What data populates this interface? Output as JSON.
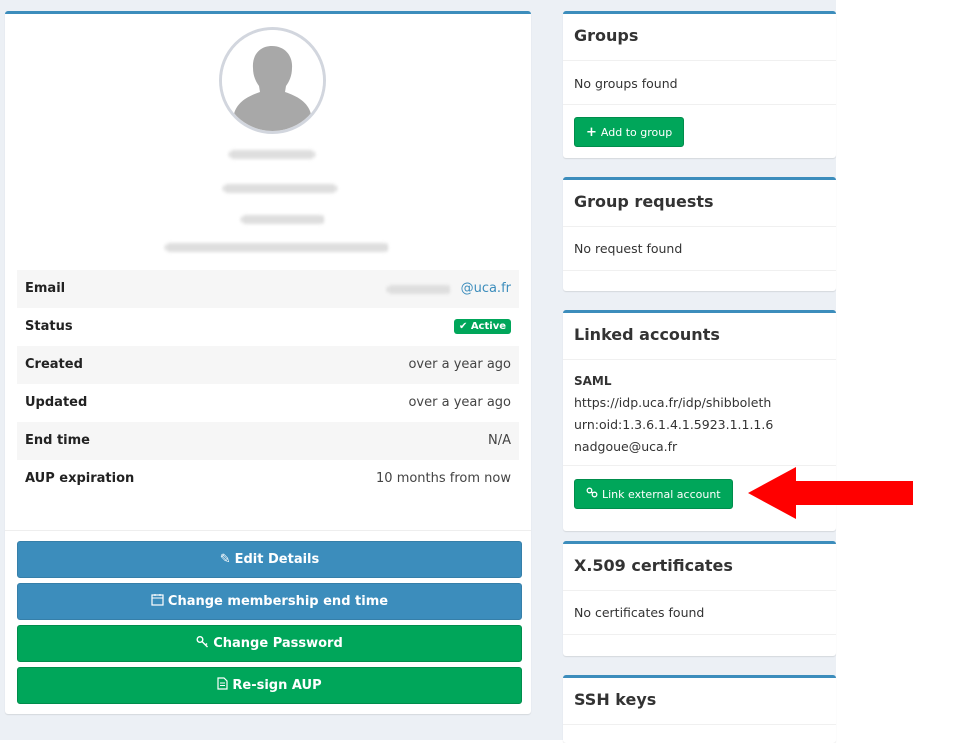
{
  "profile": {
    "info": [
      {
        "label": "Email",
        "value": "@uca.fr"
      },
      {
        "label": "Status",
        "value": "Active"
      },
      {
        "label": "Created",
        "value": "over a year ago"
      },
      {
        "label": "Updated",
        "value": "over a year ago"
      },
      {
        "label": "End time",
        "value": "N/A"
      },
      {
        "label": "AUP expiration",
        "value": "10 months from now"
      }
    ],
    "buttons": {
      "edit": "Edit Details",
      "membership": "Change membership end time",
      "password": "Change Password",
      "aup": "Re-sign AUP"
    }
  },
  "groups": {
    "title": "Groups",
    "empty": "No groups found",
    "add_button": "Add to group"
  },
  "group_requests": {
    "title": "Group requests",
    "empty": "No request found"
  },
  "linked_accounts": {
    "title": "Linked accounts",
    "type": "SAML",
    "idp": "https://idp.uca.fr/idp/shibboleth",
    "attribute": "urn:oid:1.3.6.1.4.1.5923.1.1.1.6",
    "value": "nadgoue@uca.fr",
    "link_button": "Link external account"
  },
  "certificates": {
    "title": "X.509 certificates",
    "empty": "No certificates found"
  },
  "ssh": {
    "title": "SSH keys"
  },
  "colors": {
    "primary": "#3c8dbc",
    "success": "#00a65a",
    "arrow": "#ff0000",
    "background": "#ecf0f5"
  }
}
